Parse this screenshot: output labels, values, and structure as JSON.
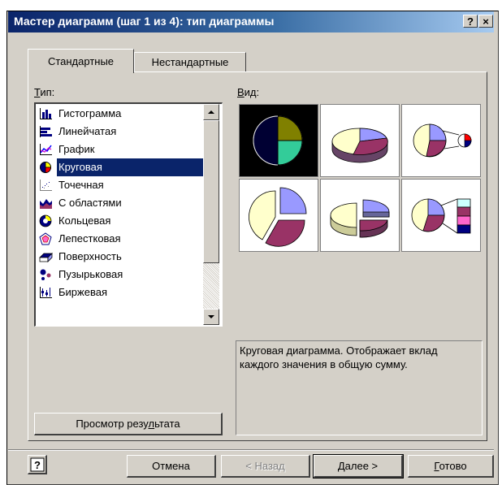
{
  "window": {
    "title": "Мастер диаграмм (шаг 1 из 4): тип диаграммы",
    "help_button": "?",
    "close_button": "×"
  },
  "tabs": [
    {
      "label": "Стандартные",
      "active": true
    },
    {
      "label": "Нестандартные",
      "active": false
    }
  ],
  "type_label_first": "Т",
  "type_label_rest": "ип:",
  "view_label_first": "В",
  "view_label_rest": "ид:",
  "chart_types": [
    {
      "label": "Гистограмма",
      "icon": "column-chart-icon"
    },
    {
      "label": "Линейчатая",
      "icon": "bar-chart-icon"
    },
    {
      "label": "График",
      "icon": "line-chart-icon"
    },
    {
      "label": "Круговая",
      "icon": "pie-chart-icon",
      "selected": true
    },
    {
      "label": "Точечная",
      "icon": "scatter-chart-icon"
    },
    {
      "label": "С областями",
      "icon": "area-chart-icon"
    },
    {
      "label": "Кольцевая",
      "icon": "doughnut-chart-icon"
    },
    {
      "label": "Лепестковая",
      "icon": "radar-chart-icon"
    },
    {
      "label": "Поверхность",
      "icon": "surface-chart-icon"
    },
    {
      "label": "Пузырьковая",
      "icon": "bubble-chart-icon"
    },
    {
      "label": "Биржевая",
      "icon": "stock-chart-icon"
    }
  ],
  "subtypes_selected_index": 0,
  "description": "Круговая диаграмма. Отображает вклад каждого значения в общую сумму.",
  "buttons": {
    "preview_pre": "Просмотр резу",
    "preview_ul": "л",
    "preview_post": "ьтата",
    "cancel": "Отмена",
    "back": "< Назад",
    "next_ul": "Д",
    "next_rest": "алее >",
    "finish_ul": "Г",
    "finish_rest": "отово"
  },
  "colors": {
    "title_bar": "#0a246a",
    "selection": "#0a246a",
    "pie_a": "#9999ff",
    "pie_b": "#993366",
    "pie_c": "#ffffcc"
  }
}
